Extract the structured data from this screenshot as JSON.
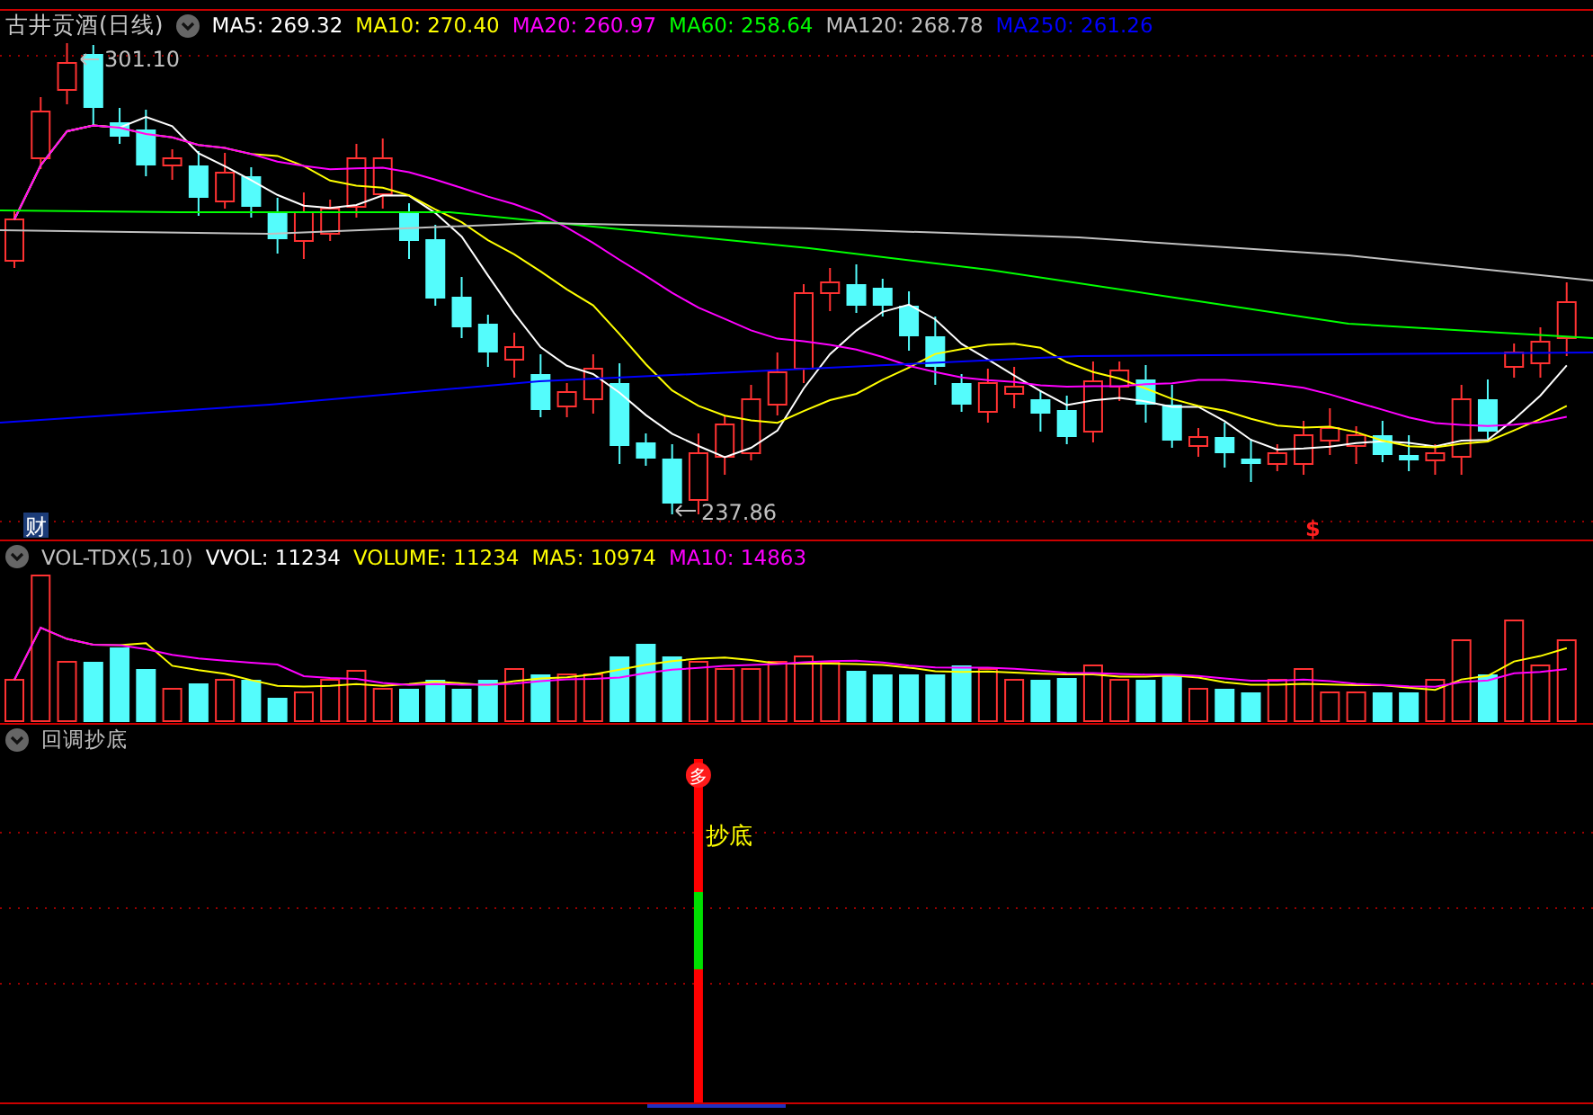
{
  "chart_title": "古井贡酒(日线)",
  "ma_legend": [
    {
      "label": "MA5: 269.32",
      "color": "#ffffff"
    },
    {
      "label": "MA10: 270.40",
      "color": "#ffff00"
    },
    {
      "label": "MA20: 260.97",
      "color": "#ff00ff"
    },
    {
      "label": "MA60: 258.64",
      "color": "#00ff00"
    },
    {
      "label": "MA120: 268.78",
      "color": "#c0c0c0"
    },
    {
      "label": "MA250: 261.26",
      "color": "#0000ff"
    }
  ],
  "high_label": "301.10",
  "low_label": "237.86",
  "finance_badge": "财",
  "event_marker": "$",
  "volume_panel": {
    "name": "VOL-TDX(5,10)",
    "legend": [
      {
        "label": "VVOL: 11234",
        "color": "#ffffff"
      },
      {
        "label": "VOLUME: 11234",
        "color": "#ffff00"
      },
      {
        "label": "MA5: 10974",
        "color": "#ffff00"
      },
      {
        "label": "MA10: 14863",
        "color": "#ff00ff"
      }
    ]
  },
  "indicator_panel": {
    "name": "回调抄底",
    "signal_label": "抄底",
    "signal_badge": "多"
  }
}
